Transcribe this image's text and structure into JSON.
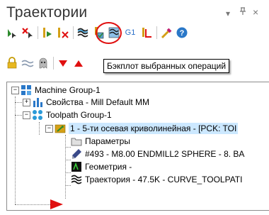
{
  "panel": {
    "title": "Траектории",
    "controls": {
      "dropdown": "▾",
      "pin": "ᵖ",
      "close": "×"
    }
  },
  "toolbar": {
    "row1": [
      "select-all-icon",
      "deselect-icon",
      "regenerate-icon",
      "regenerate-dirty-icon",
      "backplot-icon",
      "verify-icon",
      "simulate-icon",
      "post-icon",
      "toggle-display-icon",
      "highlight-icon",
      "help-icon"
    ],
    "g1_label": "G1",
    "row2": [
      "lock-icon",
      "toggle-posting-icon",
      "ghost-icon",
      "move-down-icon",
      "move-up-icon"
    ]
  },
  "tooltip": {
    "text": "Бэкплот выбранных операций"
  },
  "tree": {
    "items": [
      {
        "label": "Machine Group-1",
        "expander": "−",
        "icon": "machine-group-icon"
      },
      {
        "label": "Свойства - Mill Default MM",
        "expander": "+",
        "icon": "properties-icon"
      },
      {
        "label": "Toolpath Group-1",
        "expander": "−",
        "icon": "toolpath-group-icon"
      },
      {
        "label": "1 - 5-ти осевая криволинейная - [PCK: TOI",
        "expander": "−",
        "icon": "operation-icon"
      },
      {
        "label": "Параметры",
        "icon": "folder-icon"
      },
      {
        "label": "#493 - M8.00 ENDMILL2 SPHERE - 8. BA",
        "icon": "tool-icon"
      },
      {
        "label": "Геометрия -",
        "icon": "geometry-icon"
      },
      {
        "label": "Траектория - 47.5K - CURVE_TOOLPATI",
        "icon": "toolpath-icon"
      }
    ]
  },
  "colors": {
    "accent_red": "#e01010",
    "tree_border": "#8c8c8c",
    "operation_highlight": "#cce8ff"
  }
}
